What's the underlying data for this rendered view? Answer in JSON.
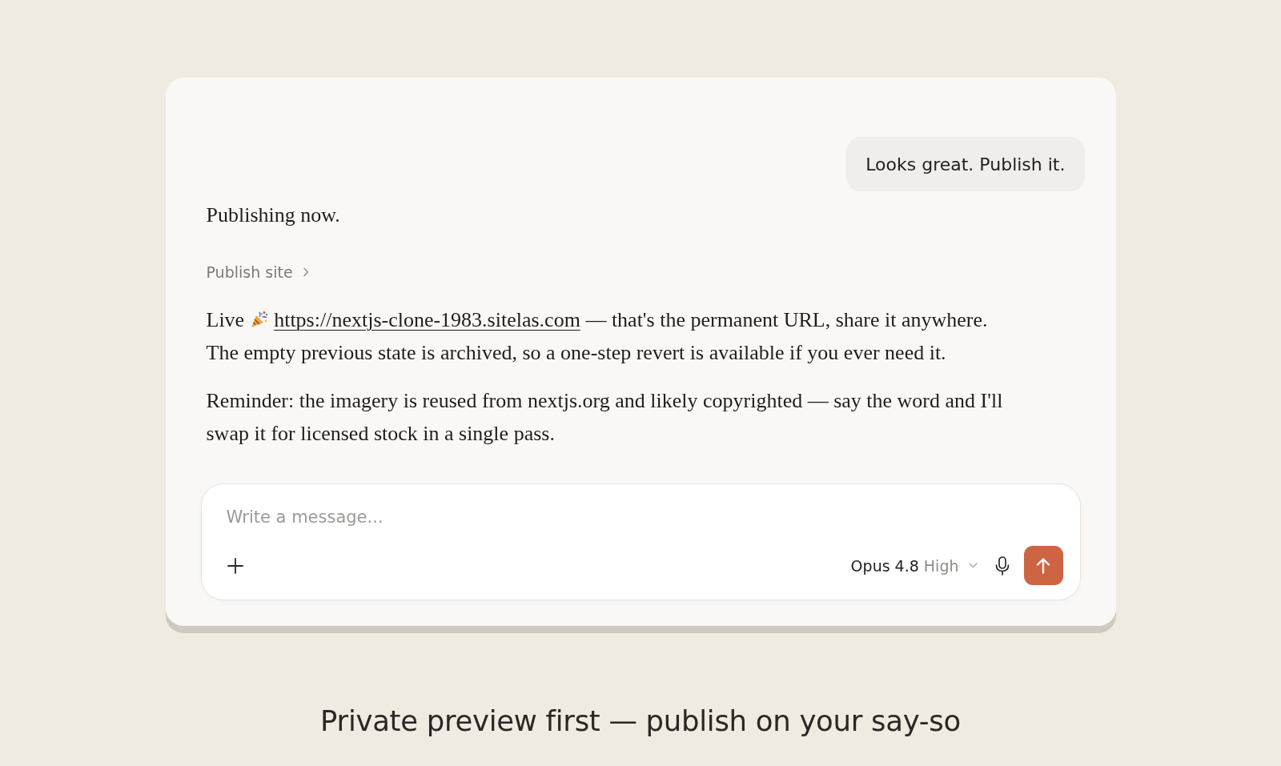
{
  "conversation": {
    "user_message": {
      "text": "Looks great. Publish it."
    },
    "assistant_blocks": [
      {
        "kind": "text",
        "text": "Publishing now."
      },
      {
        "kind": "tool",
        "label": "Publish site",
        "expanded": false
      },
      {
        "kind": "link_text",
        "before": "Live",
        "link": "https://nextjs-clone-1983.sitelas.com",
        "after": "— that's the permanent URL, share it anywhere. The empty previous state is archived, so a one-step revert is available if you ever need it."
      },
      {
        "kind": "text",
        "text": "Reminder: the imagery is reused from nextjs.org and likely copyrighted — say the word and I'll swap it for licensed stock in a single pass."
      }
    ]
  },
  "composer": {
    "placeholder": "Write a message...",
    "model": "Opus 4.8",
    "effort": "High"
  },
  "caption": "Private preview first — publish on your say-so"
}
